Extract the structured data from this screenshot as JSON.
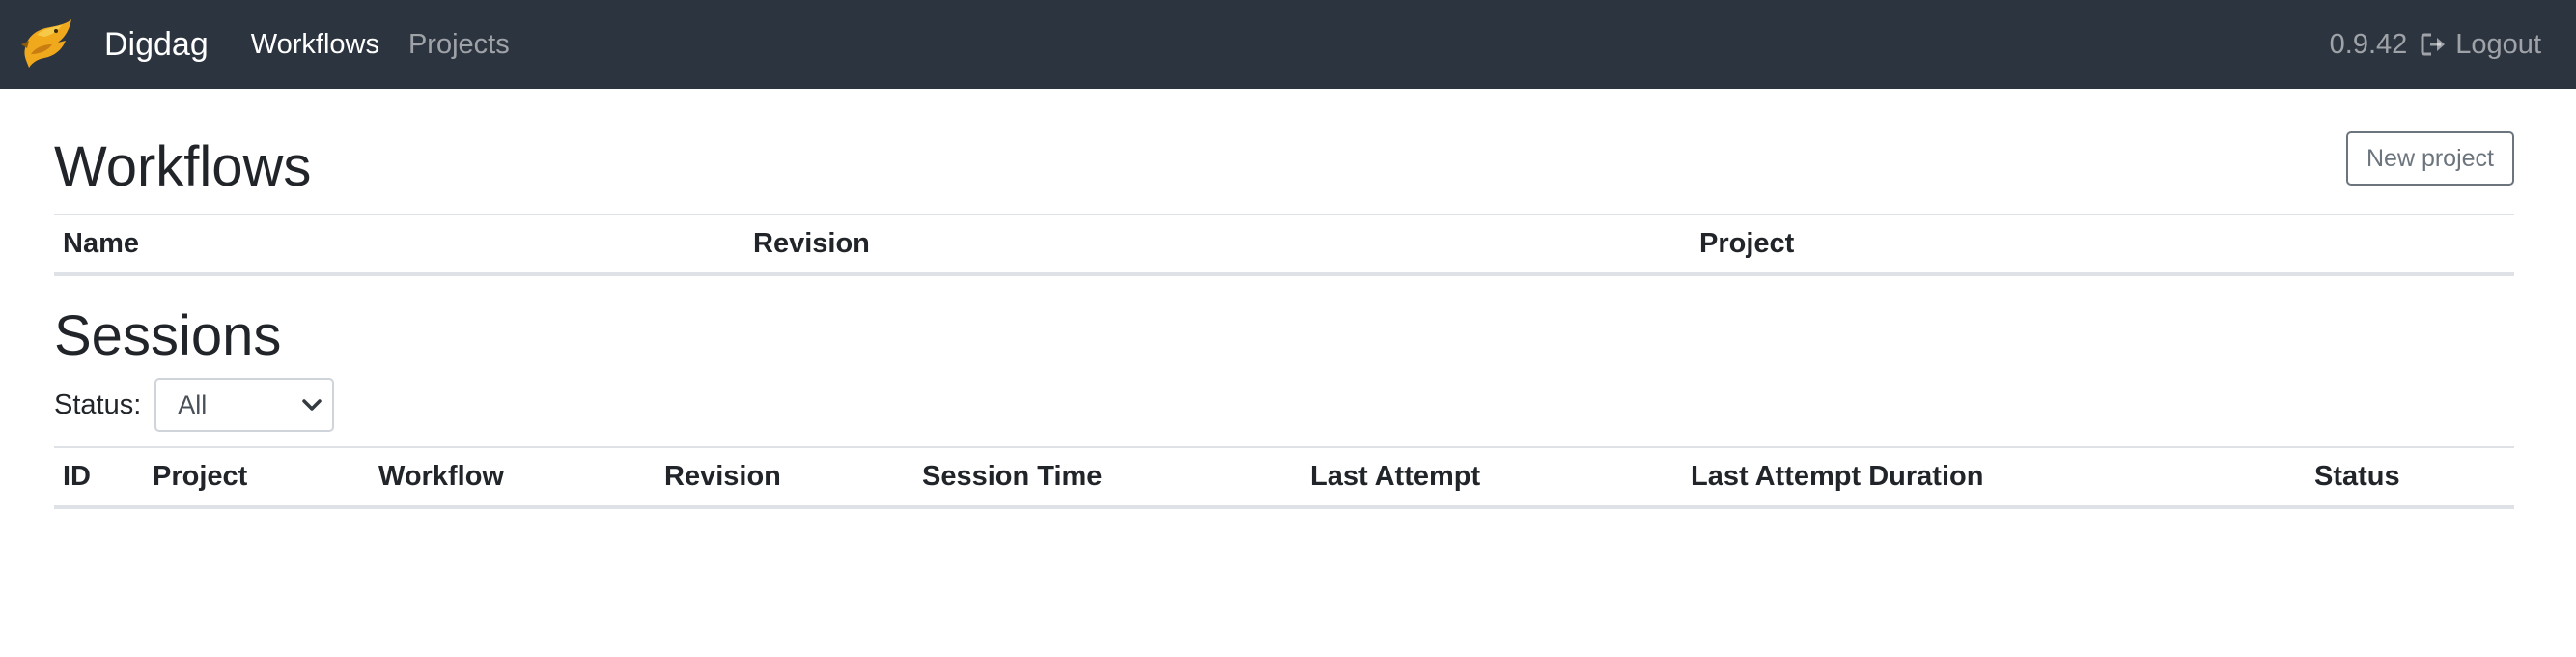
{
  "navbar": {
    "brand": "Digdag",
    "links": [
      {
        "label": "Workflows",
        "active": true
      },
      {
        "label": "Projects",
        "active": false
      }
    ],
    "version": "0.9.42",
    "logout_label": "Logout",
    "logout_icon": "sign-out-icon",
    "logo_icon": "digdag-logo-icon",
    "background_color": "#2c343f"
  },
  "workflows": {
    "title": "Workflows",
    "new_project_label": "New project",
    "columns": [
      "Name",
      "Revision",
      "Project"
    ],
    "rows": []
  },
  "sessions": {
    "title": "Sessions",
    "status_label": "Status:",
    "status_selected": "All",
    "columns": [
      "ID",
      "Project",
      "Workflow",
      "Revision",
      "Session Time",
      "Last Attempt",
      "Last Attempt Duration",
      "Status"
    ],
    "rows": []
  }
}
